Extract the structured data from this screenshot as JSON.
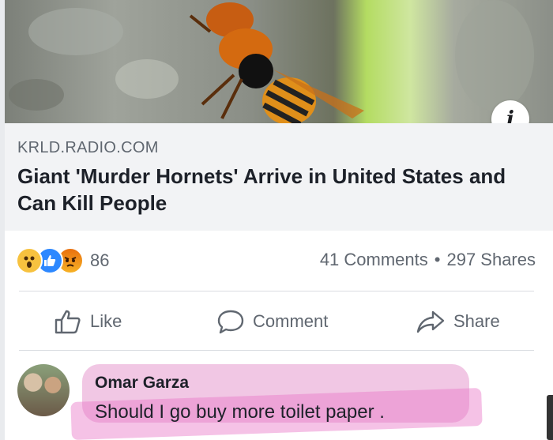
{
  "link_preview": {
    "domain": "KRLD.RADIO.COM",
    "title": "Giant 'Murder Hornets' Arrive in United States and Can Kill People",
    "info_symbol": "i"
  },
  "engagement": {
    "reactions": [
      "wow",
      "like",
      "angry"
    ],
    "reaction_count": "86",
    "comments": "41 Comments",
    "separator": "•",
    "shares": "297 Shares"
  },
  "actions": {
    "like_label": "Like",
    "comment_label": "Comment",
    "share_label": "Share"
  },
  "comment": {
    "author": "Omar Garza",
    "text": "Should I go buy more toilet paper ."
  },
  "colors": {
    "secondary_text": "#606770",
    "link_box_bg": "#f2f3f5",
    "like_blue": "#2d88ff",
    "highlight_pink": "#e878c8"
  }
}
